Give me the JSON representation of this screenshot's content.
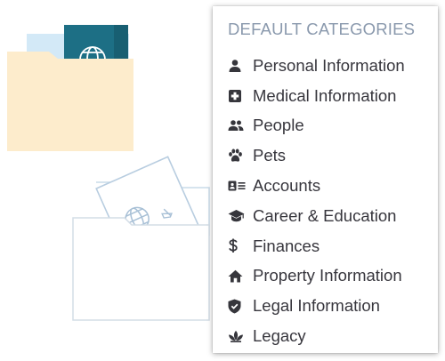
{
  "menu": {
    "header": "DEFAULT CATEGORIES",
    "items": [
      {
        "label": "Personal Information",
        "icon": "person-icon"
      },
      {
        "label": "Medical Information",
        "icon": "medical-cross-icon"
      },
      {
        "label": "People",
        "icon": "people-icon"
      },
      {
        "label": "Pets",
        "icon": "paw-icon"
      },
      {
        "label": "Accounts",
        "icon": "id-card-icon"
      },
      {
        "label": "Career & Education",
        "icon": "graduation-cap-icon"
      },
      {
        "label": "Finances",
        "icon": "dollar-icon"
      },
      {
        "label": "Property Information",
        "icon": "house-icon"
      },
      {
        "label": "Legal Information",
        "icon": "shield-check-icon"
      },
      {
        "label": "Legacy",
        "icon": "lotus-icon"
      }
    ]
  },
  "colors": {
    "header_text": "#8a99ad",
    "item_text": "#37363d",
    "icon": "#36363c",
    "folder_fill": "#fdeccc",
    "passport_fill": "#1d6f85",
    "outline": "#b8cde0"
  }
}
